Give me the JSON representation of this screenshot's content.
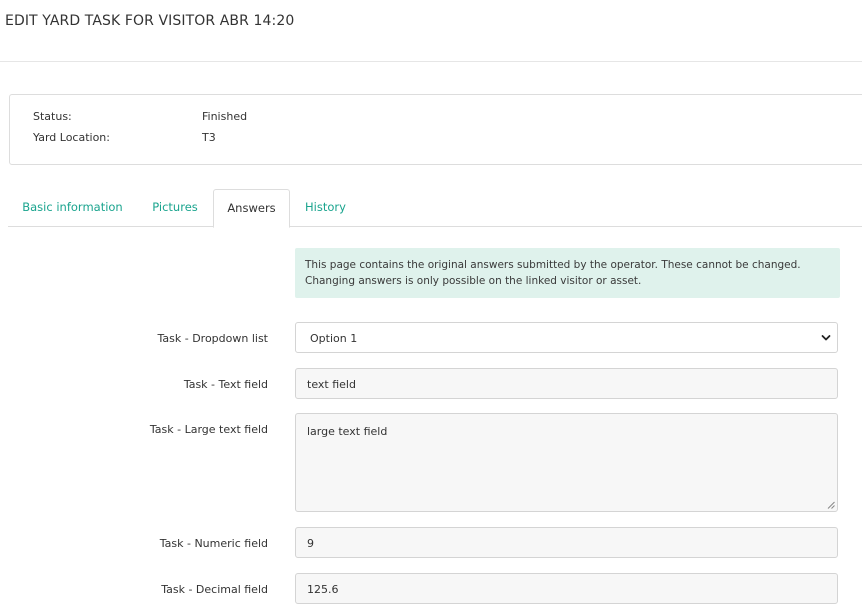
{
  "header": {
    "title": "EDIT YARD TASK FOR VISITOR ABR 14:20"
  },
  "info": {
    "status_label": "Status:",
    "status_value": "Finished",
    "location_label": "Yard Location:",
    "location_value": "T3"
  },
  "tabs": [
    {
      "label": "Basic information",
      "active": false
    },
    {
      "label": "Pictures",
      "active": false
    },
    {
      "label": "Answers",
      "active": true
    },
    {
      "label": "History",
      "active": false
    }
  ],
  "notice": {
    "line1": "This page contains the original answers submitted by the operator. These cannot be changed.",
    "line2": "Changing answers is only possible on the linked visitor or asset."
  },
  "form": {
    "dropdown": {
      "label": "Task - Dropdown list",
      "value": "Option 1"
    },
    "text": {
      "label": "Task - Text field",
      "value": "text field"
    },
    "large_text": {
      "label": "Task - Large text field",
      "value": "large text field"
    },
    "numeric": {
      "label": "Task - Numeric field",
      "value": "9"
    },
    "decimal": {
      "label": "Task - Decimal field",
      "value": "125.6"
    }
  },
  "colors": {
    "accent": "#1aa48e",
    "notice_background": "#dff2ec",
    "field_background": "#f7f7f7",
    "border": "#dddddd"
  },
  "icons": {
    "select_chevron": "chevron-down-icon",
    "textarea_resize": "resize-grip-icon"
  }
}
